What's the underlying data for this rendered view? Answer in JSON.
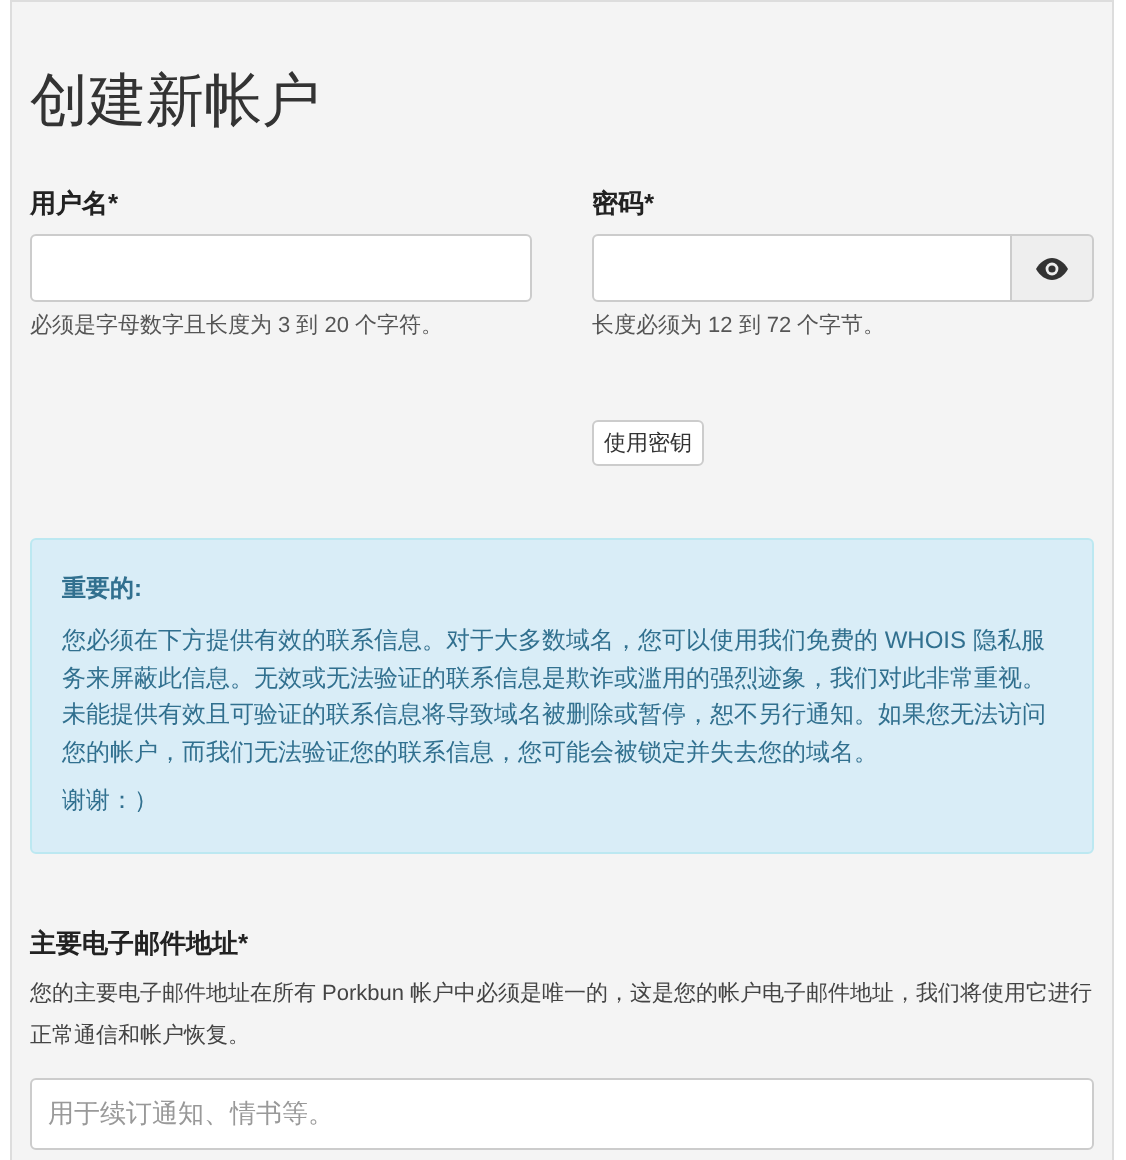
{
  "title": "创建新帐户",
  "username": {
    "label": "用户名*",
    "hint": "必须是字母数字且长度为 3 到 20 个字符。"
  },
  "password": {
    "label": "密码*",
    "hint": "长度必须为 12 到 72 个字节。",
    "passkey_button": "使用密钥"
  },
  "notice": {
    "heading": "重要的:",
    "body": "您必须在下方提供有效的联系信息。对于大多数域名，您可以使用我们免费的 WHOIS 隐私服务来屏蔽此信息。无效或无法验证的联系信息是欺诈或滥用的强烈迹象，我们对此非常重视。未能提供有效且可验证的联系信息将导致域名被删除或暂停，恕不另行通知。如果您无法访问您的帐户，而我们无法验证您的联系信息，您可能会被锁定并失去您的域名。",
    "thanks": "谢谢：）"
  },
  "email": {
    "label": "主要电子邮件地址*",
    "hint": "您的主要电子邮件地址在所有 Porkbun 帐户中必须是唯一的，这是您的帐户电子邮件地址，我们将使用它进行正常通信和帐户恢复。",
    "placeholder": "用于续订通知、情书等。"
  }
}
